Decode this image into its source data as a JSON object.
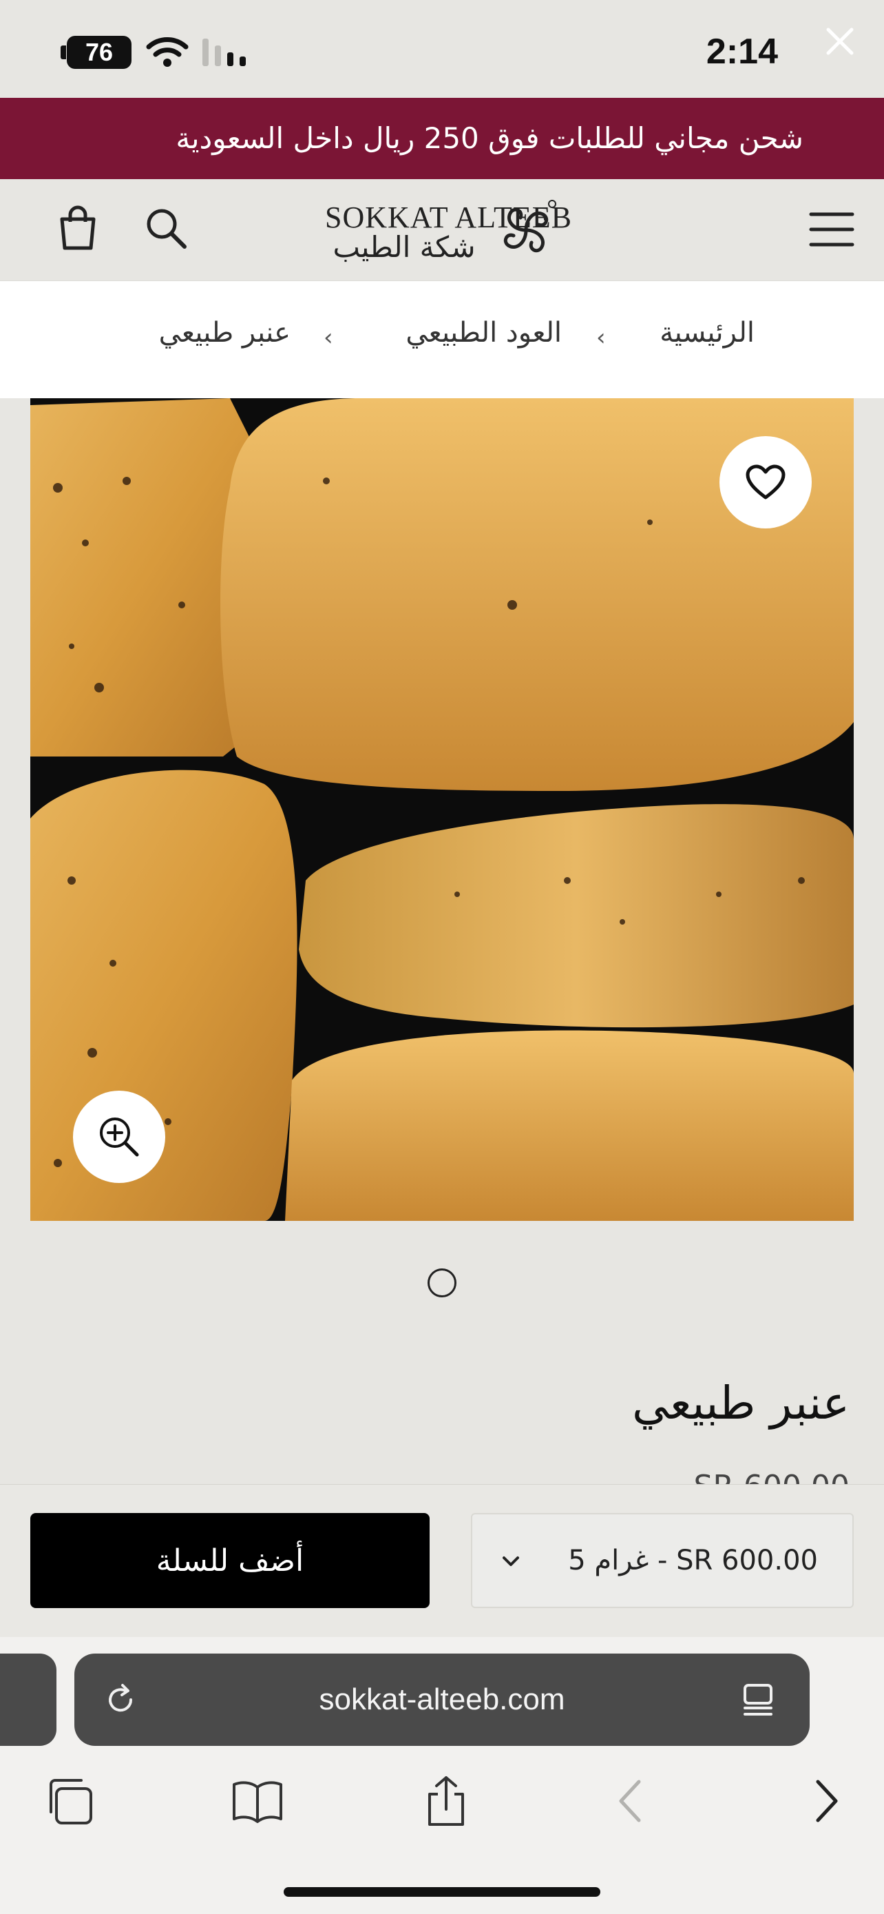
{
  "status_bar": {
    "time": "2:14",
    "battery": "76"
  },
  "promo": {
    "text": "شحن مجاني للطلبات فوق 250 ريال داخل السعودية"
  },
  "header": {
    "logo_latin": "SOKKAT ALTEEB",
    "logo_arabic": "شكة الطيب"
  },
  "breadcrumb": {
    "items": [
      "الرئيسية",
      "العود الطبيعي",
      "عنبر طبيعي"
    ],
    "separator": "‹"
  },
  "product": {
    "title": "عنبر طبيعي",
    "price_peek": "SR 600.00"
  },
  "cart_bar": {
    "add_to_cart_label": "أضف للسلة",
    "variant_selected": "5 غرام - SR 600.00"
  },
  "browser": {
    "url": "sokkat-alteeb.com"
  },
  "colors": {
    "promo_bg": "#7b1535",
    "button_bg": "#000000",
    "page_bg": "#e7e6e2"
  }
}
